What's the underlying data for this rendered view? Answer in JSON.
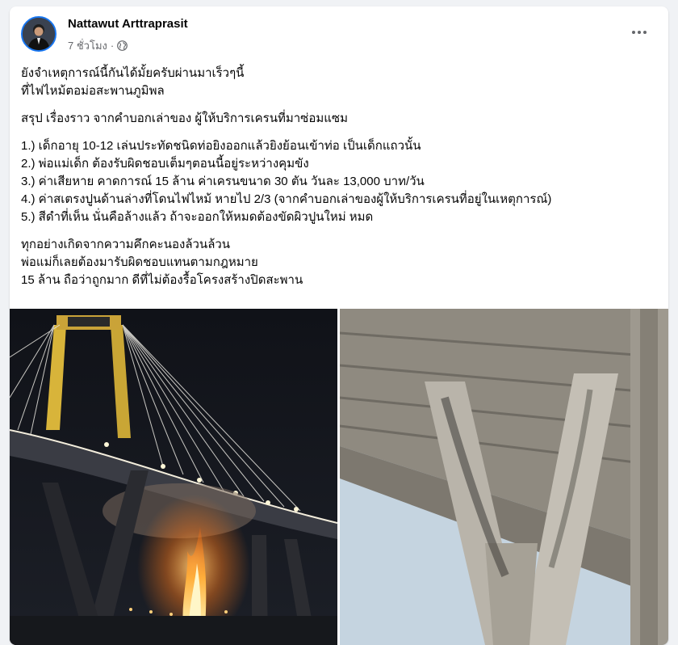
{
  "post": {
    "author": "Nattawut Arttraprasit",
    "time": "7 ชั่วโมง",
    "separator": "·",
    "privacy_icon": "globe-icon",
    "more_icon": "more-horizontal-icon",
    "paragraphs": [
      [
        "ยังจำเหตุการณ์นี้กันได้มั้ยครับผ่านมาเร็วๆนี้",
        "ที่ไฟไหม้ตอม่อสะพานภูมิพล"
      ],
      [
        "สรุป เรื่องราว จากคำบอกเล่าของ ผู้ให้บริการเครนที่มาซ่อมแซม"
      ],
      [
        "1.) เด็กอายุ 10-12 เล่นประทัดชนิดท่อยิงออกแล้วยิงย้อนเข้าท่อ เป็นเด็กแถวนั้น",
        "2.) พ่อแม่เด็ก ต้องรับผิดชอบเต็มๆตอนนี้อยู่ระหว่างคุมขัง",
        "3.) ค่าเสียหาย คาดการณ์ 15 ล้าน ค่าเครนขนาด 30 ตัน วันละ 13,000 บาท/วัน",
        "4.) ค่าสเตรงปูนด้านล่างที่โดนไฟไหม้ หายไป 2/3 (จากคำบอกเล่าของผู้ให้บริการเครนที่อยู่ในเหตุการณ์)",
        "5.) สีดำที่เห็น นั่นคือล้างแล้ว ถ้าจะออกให้หมดต้องขัดผิวปูนใหม่ หมด"
      ],
      [
        "ทุกอย่างเกิดจากความคึกคะนองล้วนล้วน",
        "พ่อแม่ก็เลยต้องมารับผิดชอบแทนตามกฎหมาย",
        "15 ล้าน ถือว่าถูกมาก ดีที่ไม่ต้องรื้อโครงสร้างปิดสะพาน"
      ]
    ]
  },
  "photos": {
    "left_icon": "bridge-fire-photo",
    "right_icon": "bridge-pillar-photo",
    "colors": {
      "fire": "#ff8a1c",
      "night": "#15171d",
      "concrete": "#a9a49a"
    }
  }
}
